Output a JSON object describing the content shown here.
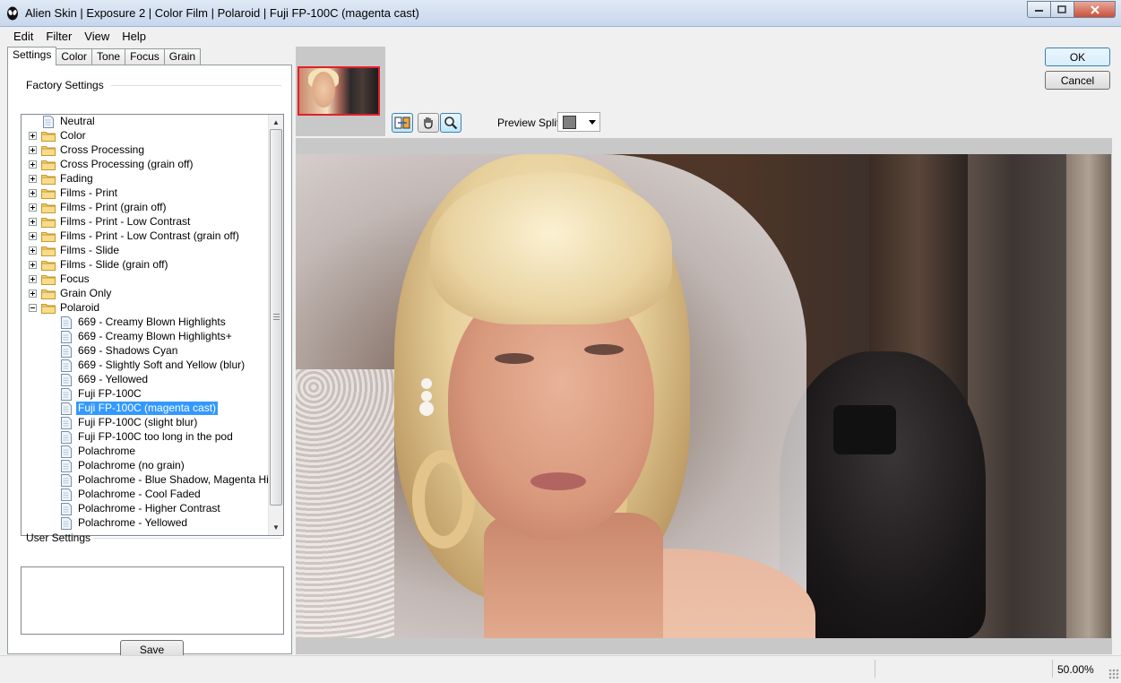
{
  "window": {
    "title": "Alien Skin | Exposure 2 | Color Film | Polaroid | Fuji FP-100C (magenta cast)",
    "icon": "alien-skin-icon"
  },
  "menu": [
    "Edit",
    "Filter",
    "View",
    "Help"
  ],
  "tabs": [
    "Settings",
    "Color",
    "Tone",
    "Focus",
    "Grain"
  ],
  "active_tab": "Settings",
  "factory_settings": {
    "label": "Factory Settings",
    "tree": [
      {
        "label": "Neutral",
        "type": "page",
        "level": 0
      },
      {
        "label": "Color",
        "type": "folder",
        "level": 0,
        "expanded": false
      },
      {
        "label": "Cross Processing",
        "type": "folder",
        "level": 0,
        "expanded": false
      },
      {
        "label": "Cross Processing (grain off)",
        "type": "folder",
        "level": 0,
        "expanded": false
      },
      {
        "label": "Fading",
        "type": "folder",
        "level": 0,
        "expanded": false
      },
      {
        "label": "Films - Print",
        "type": "folder",
        "level": 0,
        "expanded": false
      },
      {
        "label": "Films - Print (grain off)",
        "type": "folder",
        "level": 0,
        "expanded": false
      },
      {
        "label": "Films - Print - Low Contrast",
        "type": "folder",
        "level": 0,
        "expanded": false
      },
      {
        "label": "Films - Print - Low Contrast (grain off)",
        "type": "folder",
        "level": 0,
        "expanded": false
      },
      {
        "label": "Films - Slide",
        "type": "folder",
        "level": 0,
        "expanded": false
      },
      {
        "label": "Films - Slide (grain off)",
        "type": "folder",
        "level": 0,
        "expanded": false
      },
      {
        "label": "Focus",
        "type": "folder",
        "level": 0,
        "expanded": false
      },
      {
        "label": "Grain Only",
        "type": "folder",
        "level": 0,
        "expanded": false
      },
      {
        "label": "Polaroid",
        "type": "folder",
        "level": 0,
        "expanded": true
      },
      {
        "label": "669 - Creamy Blown Highlights",
        "type": "page",
        "level": 1
      },
      {
        "label": "669 - Creamy Blown Highlights+",
        "type": "page",
        "level": 1
      },
      {
        "label": "669 - Shadows Cyan",
        "type": "page",
        "level": 1
      },
      {
        "label": "669 - Slightly Soft and Yellow (blur)",
        "type": "page",
        "level": 1
      },
      {
        "label": "669 - Yellowed",
        "type": "page",
        "level": 1
      },
      {
        "label": "Fuji FP-100C",
        "type": "page",
        "level": 1
      },
      {
        "label": "Fuji FP-100C (magenta cast)",
        "type": "page",
        "level": 1,
        "selected": true
      },
      {
        "label": "Fuji FP-100C (slight blur)",
        "type": "page",
        "level": 1
      },
      {
        "label": "Fuji FP-100C too long in the pod",
        "type": "page",
        "level": 1
      },
      {
        "label": "Polachrome",
        "type": "page",
        "level": 1
      },
      {
        "label": "Polachrome (no grain)",
        "type": "page",
        "level": 1
      },
      {
        "label": "Polachrome - Blue Shadow, Magenta Highlights",
        "type": "page",
        "level": 1
      },
      {
        "label": "Polachrome - Cool Faded",
        "type": "page",
        "level": 1
      },
      {
        "label": "Polachrome - Higher Contrast",
        "type": "page",
        "level": 1
      },
      {
        "label": "Polachrome - Yellowed",
        "type": "page",
        "level": 1
      }
    ]
  },
  "user_settings": {
    "label": "User Settings"
  },
  "save_button": "Save",
  "ok_button": "OK",
  "cancel_button": "Cancel",
  "toolbar": {
    "tools": [
      "split-compare-icon",
      "hand-pan-icon",
      "zoom-magnifier-icon"
    ],
    "preview_split_label": "Preview Split:"
  },
  "status": {
    "zoom": "50.00%"
  },
  "colors": {
    "selection": "#3399ff",
    "thumbnail_border": "#e0202a"
  }
}
